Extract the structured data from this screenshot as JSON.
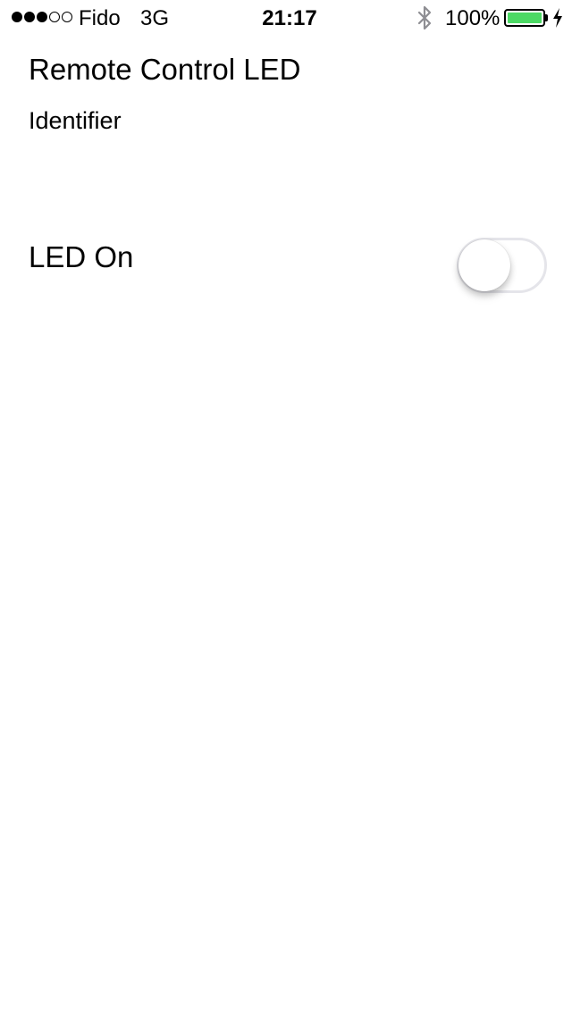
{
  "status_bar": {
    "signal_bars_total": 5,
    "signal_bars_filled": 3,
    "carrier": "Fido",
    "network": "3G",
    "time": "21:17",
    "bluetooth_icon": "bluetooth-icon",
    "battery_percent": "100%",
    "battery_level": 1.0,
    "battery_color": "#4cd964",
    "charging_icon": "bolt-icon"
  },
  "main": {
    "title": "Remote Control LED",
    "identifier_label": "Identifier",
    "led_label": "LED On",
    "led_toggle_on": false
  }
}
